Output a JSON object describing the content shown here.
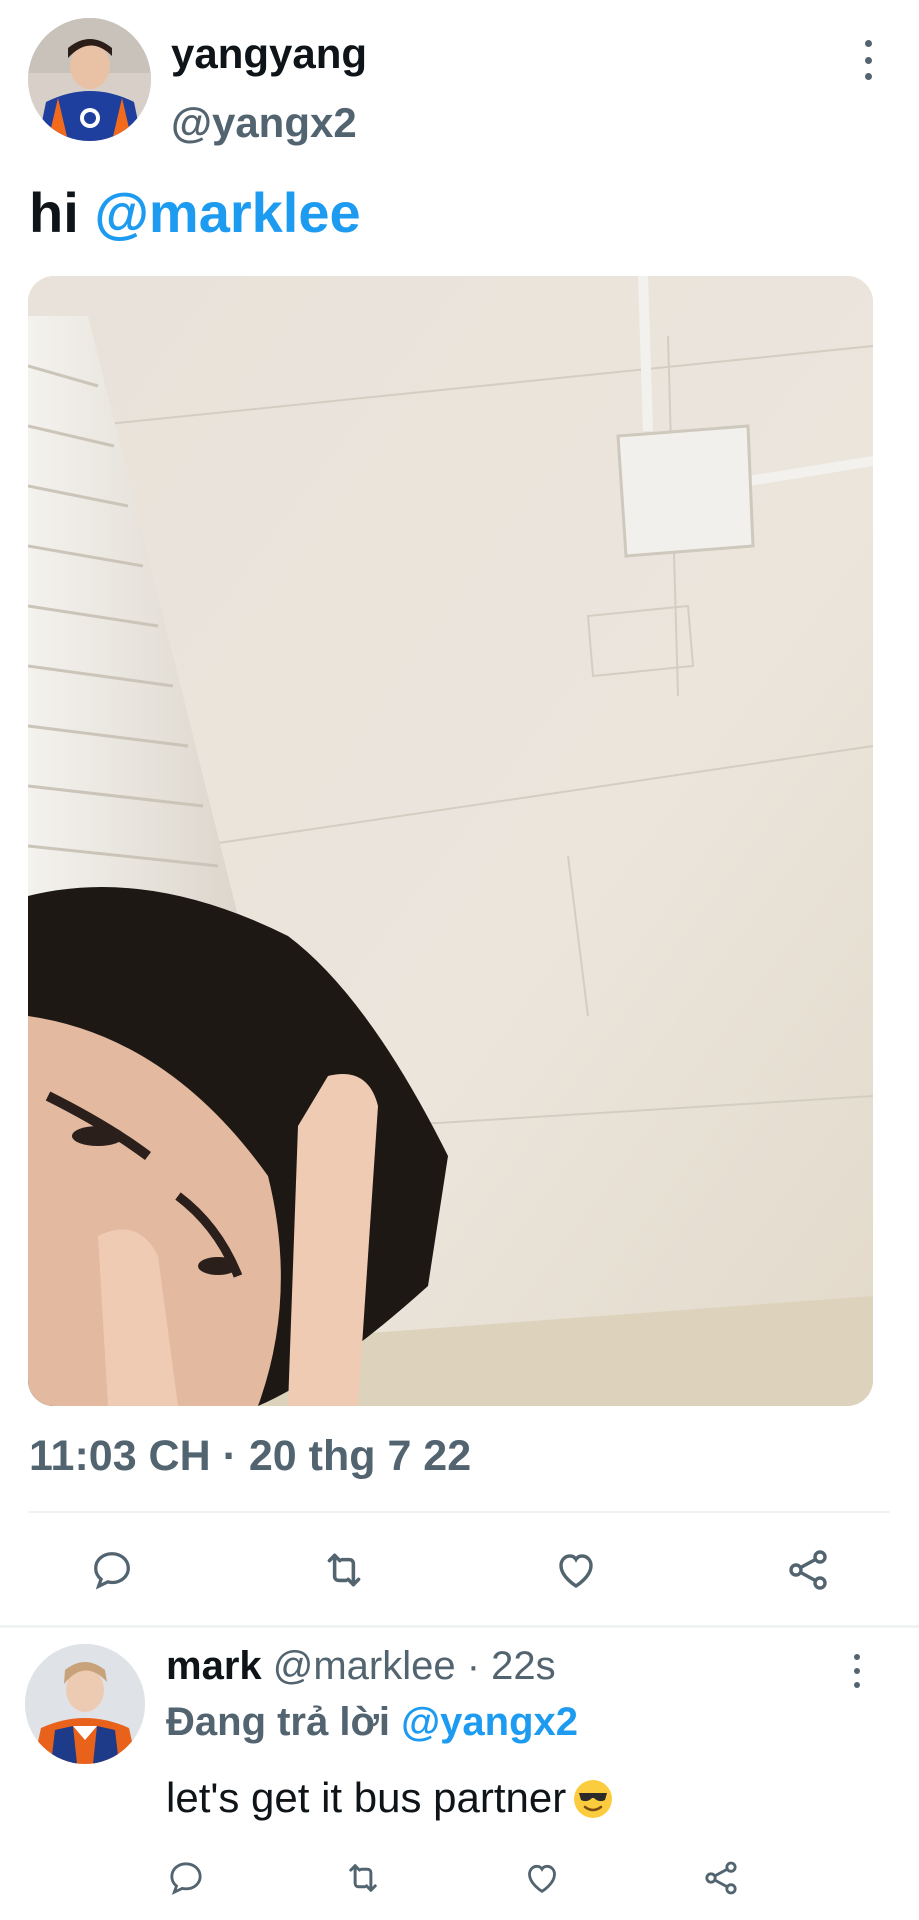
{
  "tweet": {
    "display_name": "yangyang",
    "handle": "@yangx2",
    "text_prefix": "hi ",
    "mention": "@marklee",
    "timestamp": "11:03 CH · 20 thg 7 22",
    "avatar_icon": "profile-avatar",
    "more_icon": "more-vertical-icon"
  },
  "actions": {
    "reply_icon": "reply-icon",
    "retweet_icon": "retweet-icon",
    "like_icon": "heart-icon",
    "share_icon": "share-icon"
  },
  "reply": {
    "display_name": "mark",
    "handle_time": " @marklee · 22s",
    "replying_prefix": "Đang trả lời ",
    "replying_mention": "@yangx2",
    "text": "let's get it bus partner",
    "emoji_icon": "smiling-face-with-sunglasses-icon"
  },
  "colors": {
    "accent": "#1d9bf0",
    "secondary_text": "#536471",
    "primary_text": "#0f1419",
    "divider": "#eff3f4"
  }
}
